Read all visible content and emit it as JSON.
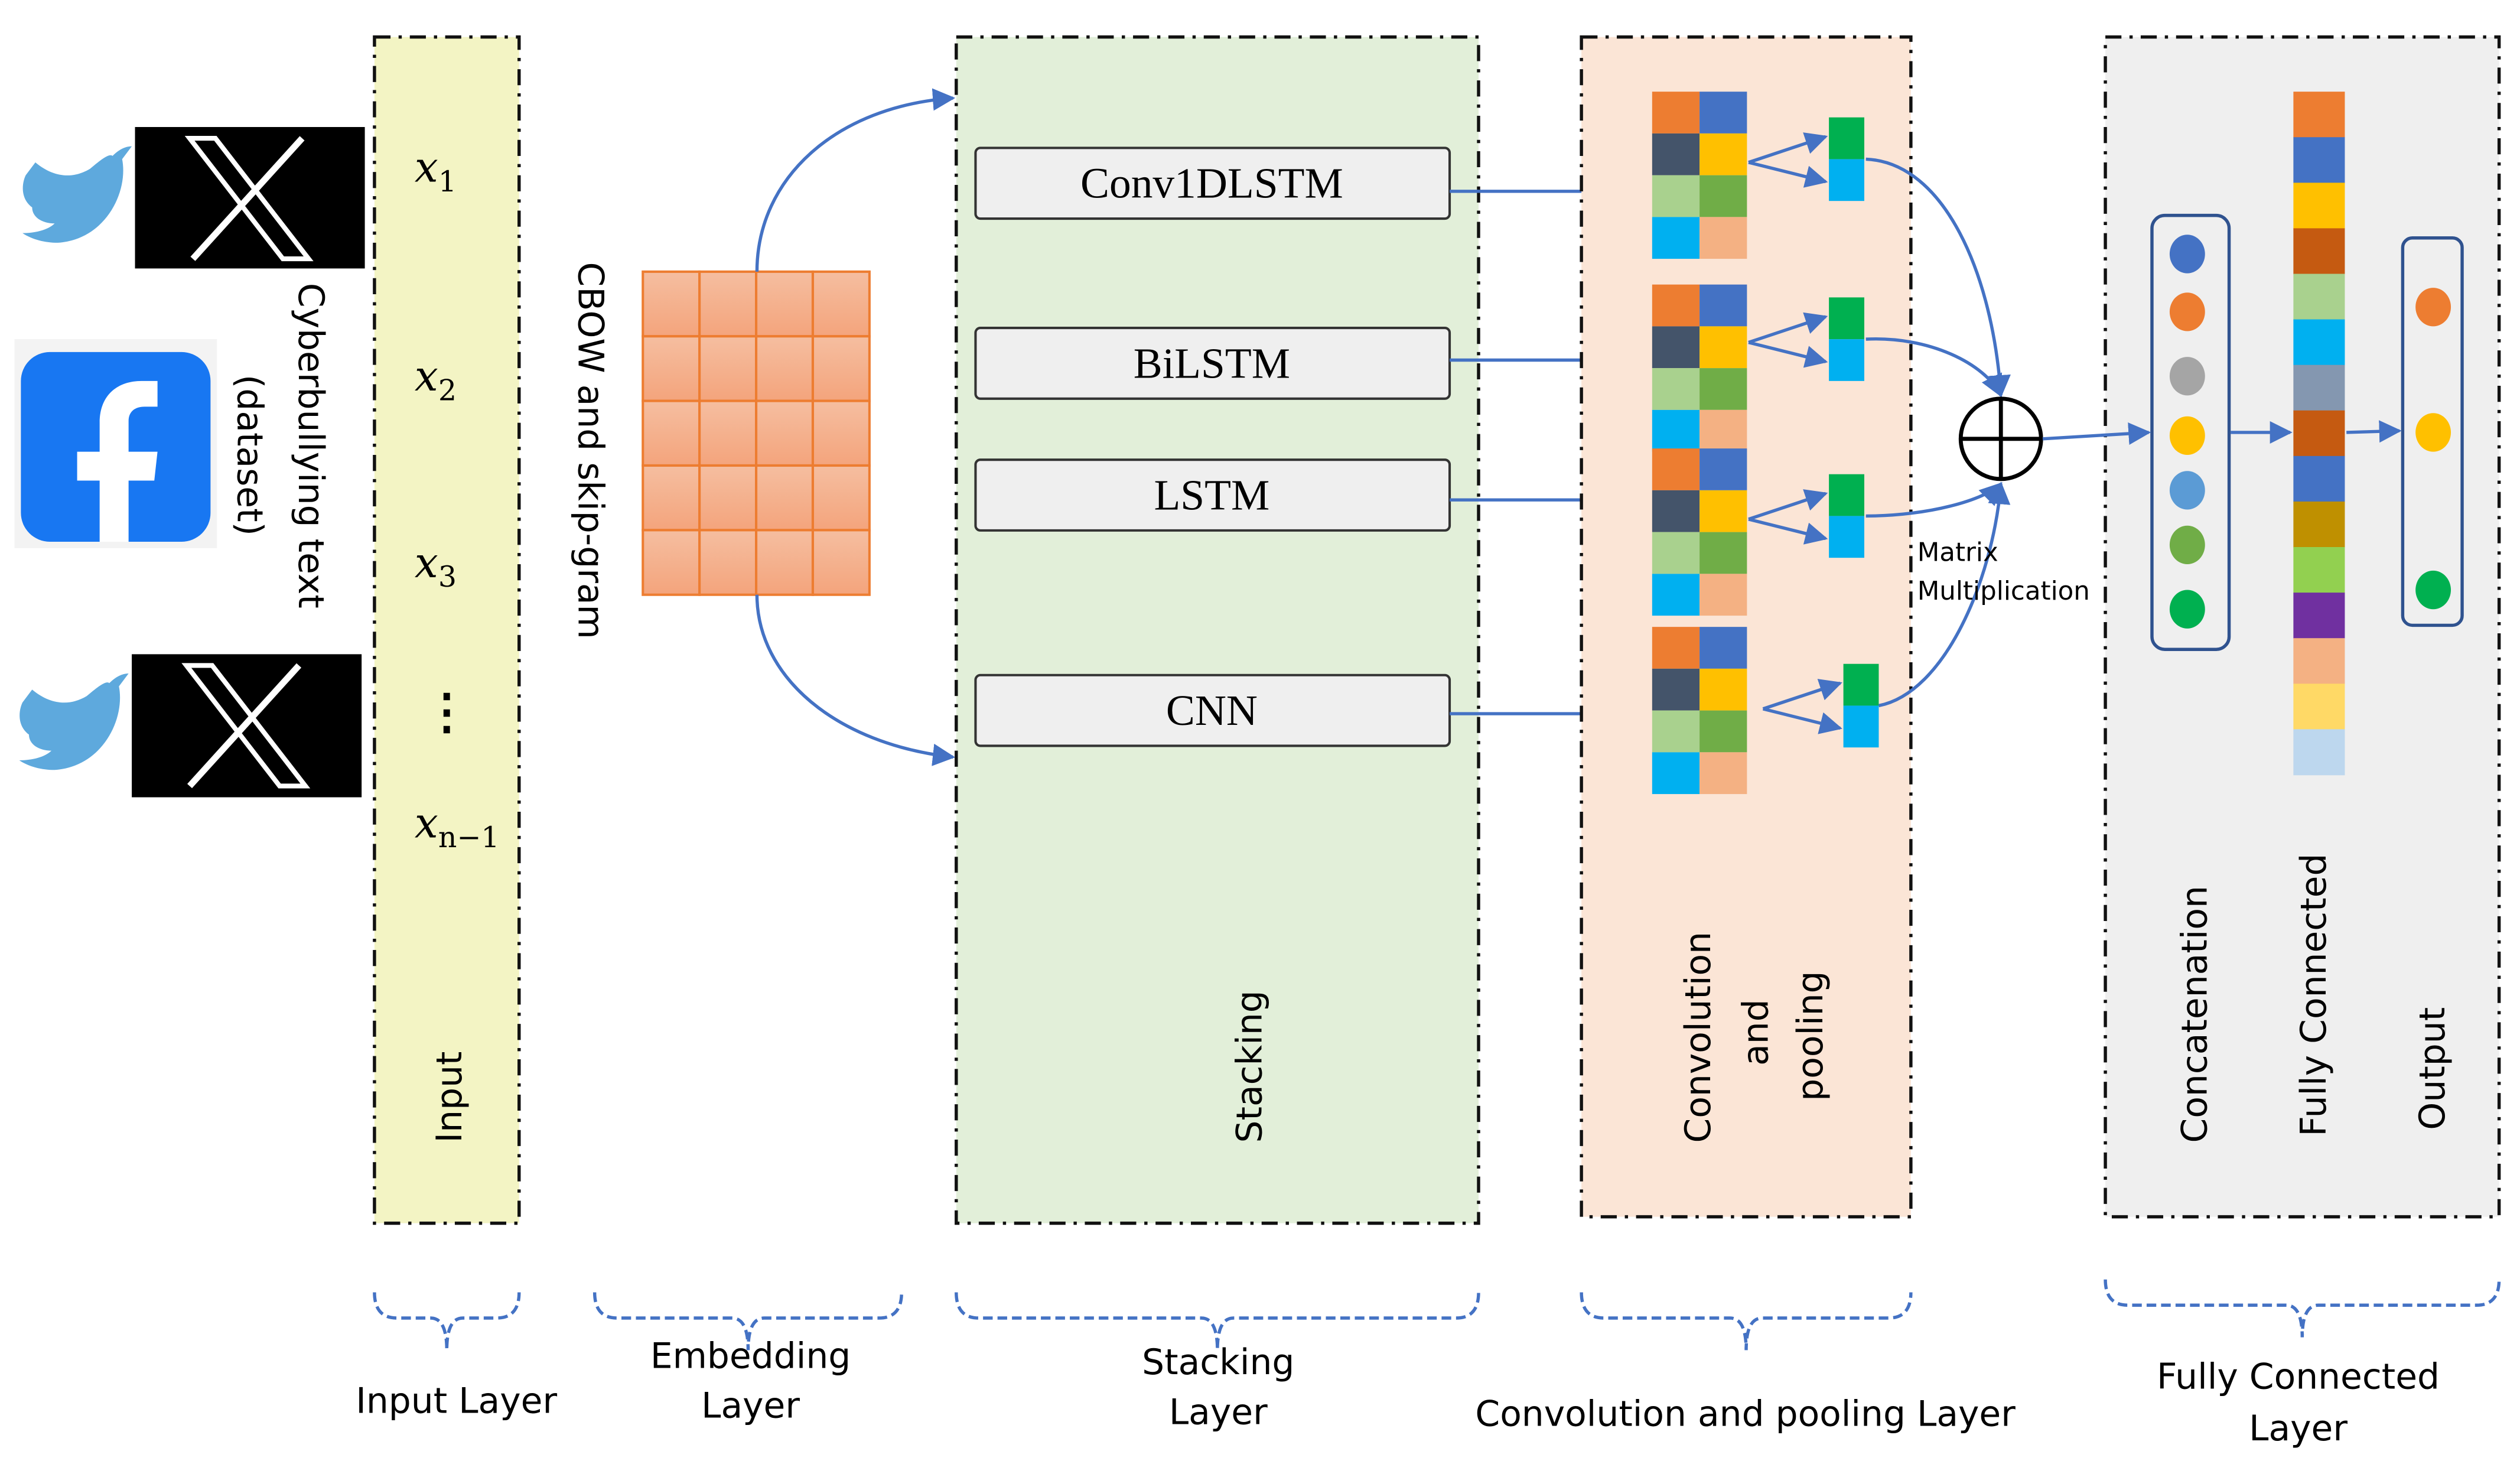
{
  "source": {
    "label": "Cyberbullying text",
    "sublabel": "(dataset)",
    "icons": [
      "twitter-icon",
      "x-logo",
      "facebook-icon",
      "twitter-icon",
      "x-logo"
    ]
  },
  "input": {
    "tokens": [
      "1",
      "2",
      "3",
      "n−1"
    ],
    "token_base": "x",
    "ellipsis": "⋮",
    "label": "Input"
  },
  "embedding": {
    "label": "CBOW and skip-gram"
  },
  "stacking": {
    "label": "Stacking",
    "models": [
      "Conv1DLSTM",
      "BiLSTM",
      "LSTM",
      "CNN"
    ]
  },
  "conv": {
    "label1": "Convolution",
    "label2": "and",
    "label3": "pooling",
    "matrix_label1": "Matrix",
    "matrix_label2": "Multiplication"
  },
  "fc": {
    "concat_label": "Concatenation",
    "fc_label": "Fully Connected",
    "output_label": "Output"
  },
  "bottom": {
    "input_layer": "Input Layer",
    "embedding_layer_1": "Embedding",
    "embedding_layer_2": "Layer",
    "stacking_layer_1": "Stacking",
    "stacking_layer_2": "Layer",
    "conv_layer": "Convolution and pooling Layer",
    "fc_layer_1": "Fully Connected",
    "fc_layer_2": "Layer"
  },
  "colors": {
    "input_bg": "#f3f4c4",
    "stacking_bg": "#e2efd9",
    "conv_bg": "#fbe5d6",
    "fc_bg": "#efefef",
    "arrow": "#4472c4",
    "grid": [
      "#ed7d31",
      "#4472c4",
      "#44546a",
      "#ffc000",
      "#a9d18e",
      "#70ad47",
      "#00b0f0",
      "#f4b183"
    ],
    "pool": [
      "#00b050",
      "#00b0f0"
    ],
    "concat": [
      "#4472c4",
      "#ed7d31",
      "#a5a5a5",
      "#ffc000",
      "#5b9bd5",
      "#70ad47",
      "#00b050"
    ],
    "fc_column": [
      "#ed7d31",
      "#4472c4",
      "#ffc000",
      "#c55a11",
      "#a9d18e",
      "#00b0f0",
      "#8497b0",
      "#c55a11",
      "#4472c4",
      "#bf9000",
      "#92d050",
      "#7030a0",
      "#f4b183",
      "#ffd966",
      "#bdd7ee"
    ],
    "output": [
      "#ed7d31",
      "#ffc000",
      "#00b050"
    ]
  }
}
